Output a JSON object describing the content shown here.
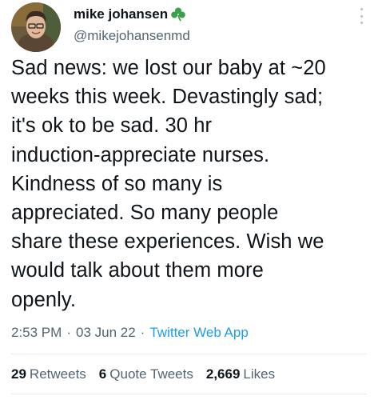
{
  "author": {
    "name": "mike johansen",
    "handle": "@mikejohansenmd",
    "badge_icon": "shamrock-icon",
    "badge_color": "#3aa04a"
  },
  "tweet": {
    "text": "Sad news: we lost our baby at ~20\nweeks this week. Devastingly sad;\nit's ok to be sad. 30 hr\ninduction-appreciate nurses.\nKindness of so many is\nappreciated. So many people\nshare these experiences. Wish we\nwould talk about them more\nopenly.",
    "time": "2:53 PM",
    "date": "03 Jun 22",
    "separator": "·",
    "source": "Twitter Web App"
  },
  "stats": {
    "retweets_count": "29",
    "retweets_label": "Retweets",
    "quote_count": "6",
    "quote_label": "Quote Tweets",
    "likes_count": "2,669",
    "likes_label": "Likes"
  },
  "colors": {
    "link": "#1d9bf0",
    "secondary_text": "#536471",
    "primary_text": "#0f1419"
  }
}
